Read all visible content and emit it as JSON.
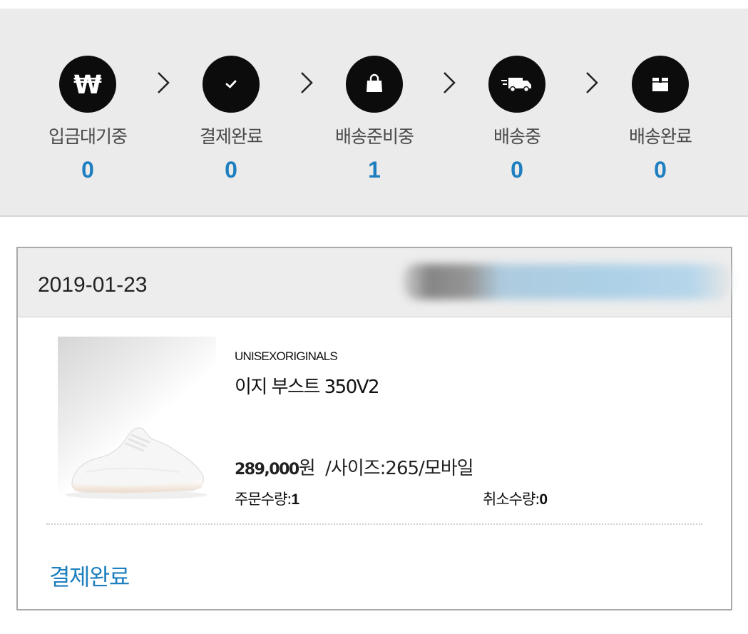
{
  "steps": [
    {
      "label": "입금대기중",
      "count": "0",
      "icon": "won-icon"
    },
    {
      "label": "결제완료",
      "count": "0",
      "icon": "check-icon"
    },
    {
      "label": "배송준비중",
      "count": "1",
      "icon": "shopping-bag-icon"
    },
    {
      "label": "배송중",
      "count": "0",
      "icon": "truck-icon"
    },
    {
      "label": "배송완료",
      "count": "0",
      "icon": "box-icon"
    }
  ],
  "order": {
    "date": "2019-01-23",
    "brand": "UNISEXORIGINALS",
    "product_name": "이지 부스트 350V2",
    "price": "289,000",
    "price_unit": "원",
    "size_text": "/사이즈:265/모바일",
    "order_qty_label": "주문수량:",
    "order_qty": "1",
    "cancel_qty_label": "취소수량:",
    "cancel_qty": "0",
    "status": "결제완료"
  },
  "colors": {
    "accent": "#1d7fc0",
    "icon_bg": "#0c0c0c",
    "panel_bg": "#ebebeb"
  }
}
